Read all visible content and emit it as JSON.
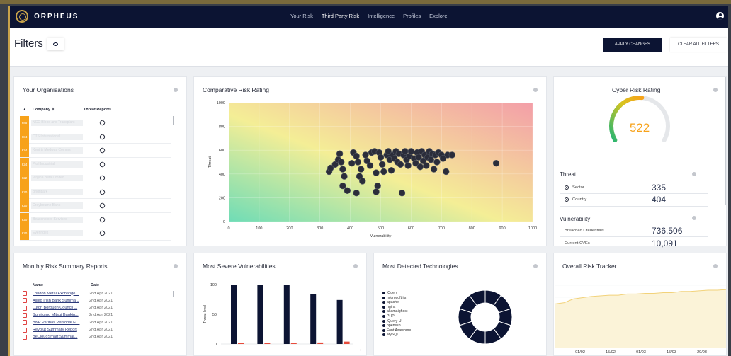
{
  "nav": {
    "brand": "ORPHEUS",
    "links": [
      "Your Risk",
      "Third Party Risk",
      "Intelligence",
      "Profiles",
      "Explore"
    ],
    "active_link": "Third Party Risk"
  },
  "filters": {
    "title": "Filters",
    "apply_label": "APPLY CHANGES",
    "clear_label": "CLEAR ALL FILTERS"
  },
  "organisations": {
    "title": "Your Organisations",
    "columns": [
      "Company ⇕",
      "Threat Reports"
    ],
    "rows": [
      {
        "score": "685",
        "name": "NCC Blood and Transplant"
      },
      {
        "score": "684",
        "name": "CTS International"
      },
      {
        "score": "624",
        "name": "Kent & Medway Comms"
      },
      {
        "score": "624",
        "name": "Pioil Industrial"
      },
      {
        "score": "622",
        "name": "Virgina Beta Limited"
      },
      {
        "score": "620",
        "name": "Brightlark"
      },
      {
        "score": "620",
        "name": "Graybourne Bank"
      },
      {
        "score": "620",
        "name": "Beaconsford Services"
      },
      {
        "score": "620",
        "name": "Everindex"
      }
    ]
  },
  "comparative": {
    "title": "Comparative Risk Rating"
  },
  "chart_data": [
    {
      "type": "scatter",
      "title": "Comparative Risk Rating",
      "xlabel": "Vulnerability",
      "ylabel": "Threat",
      "xlim": [
        0,
        1000
      ],
      "ylim": [
        0,
        1000
      ],
      "x_ticks": [
        "0",
        "100",
        "200",
        "300",
        "400",
        "500",
        "600",
        "700",
        "800",
        "900",
        "1000"
      ],
      "y_ticks": [
        "0",
        "200",
        "400",
        "600",
        "800",
        "1000"
      ],
      "points": [
        [
          330,
          420
        ],
        [
          335,
          450
        ],
        [
          350,
          480
        ],
        [
          360,
          520
        ],
        [
          365,
          570
        ],
        [
          370,
          500
        ],
        [
          375,
          440
        ],
        [
          380,
          380
        ],
        [
          375,
          300
        ],
        [
          390,
          260
        ],
        [
          405,
          490
        ],
        [
          410,
          580
        ],
        [
          420,
          550
        ],
        [
          425,
          500
        ],
        [
          435,
          440
        ],
        [
          430,
          380
        ],
        [
          420,
          240
        ],
        [
          440,
          340
        ],
        [
          450,
          560
        ],
        [
          455,
          510
        ],
        [
          465,
          470
        ],
        [
          470,
          580
        ],
        [
          480,
          590
        ],
        [
          485,
          410
        ],
        [
          490,
          300
        ],
        [
          485,
          250
        ],
        [
          495,
          580
        ],
        [
          500,
          540
        ],
        [
          505,
          480
        ],
        [
          510,
          420
        ],
        [
          520,
          560
        ],
        [
          525,
          590
        ],
        [
          530,
          520
        ],
        [
          535,
          430
        ],
        [
          540,
          560
        ],
        [
          545,
          530
        ],
        [
          550,
          590
        ],
        [
          555,
          500
        ],
        [
          560,
          570
        ],
        [
          565,
          480
        ],
        [
          570,
          240
        ],
        [
          575,
          560
        ],
        [
          580,
          590
        ],
        [
          585,
          520
        ],
        [
          590,
          470
        ],
        [
          595,
          550
        ],
        [
          600,
          590
        ],
        [
          610,
          530
        ],
        [
          615,
          490
        ],
        [
          620,
          580
        ],
        [
          625,
          540
        ],
        [
          630,
          460
        ],
        [
          635,
          590
        ],
        [
          640,
          510
        ],
        [
          645,
          560
        ],
        [
          650,
          470
        ],
        [
          655,
          540
        ],
        [
          660,
          590
        ],
        [
          665,
          520
        ],
        [
          670,
          570
        ],
        [
          675,
          440
        ],
        [
          680,
          560
        ],
        [
          685,
          500
        ],
        [
          690,
          580
        ],
        [
          700,
          560
        ],
        [
          705,
          530
        ],
        [
          715,
          420
        ],
        [
          720,
          560
        ],
        [
          735,
          560
        ],
        [
          880,
          490
        ]
      ]
    },
    {
      "type": "bar",
      "title": "Most Severe Vulnerabilities",
      "ylabel": "Threat level",
      "ylim": [
        0,
        100
      ],
      "y_ticks": [
        "0",
        "50",
        "100"
      ],
      "series": [
        {
          "values": [
            100,
            100,
            100,
            84,
            74
          ]
        },
        {
          "values": [
            1.5,
            2,
            2,
            2.5,
            4
          ]
        }
      ],
      "colors": [
        "#0c1433",
        "#e74c3c"
      ]
    },
    {
      "type": "pie",
      "title": "Most Detected Technologies",
      "categories": [
        "jQuery",
        "microsoft iis",
        "apache",
        "nginx",
        "akamaighost",
        "PHP",
        "jQuery UI",
        "openssh",
        "Font Awesome",
        "MySQL"
      ],
      "values": [
        10,
        10,
        10,
        10,
        10,
        10,
        10,
        10,
        10,
        10
      ]
    },
    {
      "type": "area",
      "title": "Overall Risk Tracker",
      "x_ticks": [
        "01/02",
        "15/02",
        "01/03",
        "15/03",
        "29/03"
      ],
      "values": [
        0.7,
        0.72,
        0.78,
        0.8,
        0.82,
        0.83,
        0.84,
        0.84,
        0.86,
        0.86,
        0.87,
        0.87,
        0.88,
        0.88,
        0.9,
        0.9,
        0.91,
        0.92,
        0.92,
        0.93
      ]
    }
  ],
  "cyber": {
    "title": "Cyber Risk Rating",
    "score": "522",
    "gauge_fraction": 0.52,
    "threat_label": "Threat",
    "threat_rows": [
      {
        "label": "Sector",
        "value": "335"
      },
      {
        "label": "Country",
        "value": "404"
      }
    ],
    "vuln_label": "Vulnerability",
    "vuln_rows": [
      {
        "label": "Breached Credentials",
        "value": "736,506"
      },
      {
        "label": "Current CVEs",
        "value": "10,091"
      }
    ]
  },
  "reports": {
    "title": "Monthly Risk Summary Reports",
    "columns": [
      "Name",
      "Date"
    ],
    "rows": [
      {
        "name": "London Metal Exchange...",
        "date": "2nd Apr 2021"
      },
      {
        "name": "Allied Irish Bank Summa...",
        "date": "2nd Apr 2021"
      },
      {
        "name": "Luton Borough Council ...",
        "date": "2nd Apr 2021"
      },
      {
        "name": "Sumitomo Mitsui Bankin...",
        "date": "2nd Apr 2021"
      },
      {
        "name": "BNP Paribas Personal Fi...",
        "date": "2nd Apr 2021"
      },
      {
        "name": "Revolut Summary Report",
        "date": "2nd Apr 2021"
      },
      {
        "name": "BeCloudSmart Summar...",
        "date": "2nd Apr 2021"
      }
    ]
  },
  "vulns": {
    "title": "Most Severe Vulnerabilities",
    "arrow": "→"
  },
  "tech": {
    "title": "Most Detected Technologies"
  },
  "tracker": {
    "title": "Overall Risk Tracker"
  },
  "colors": {
    "navy": "#0c1433",
    "accent": "#f7a21a",
    "gauge_green": "#22b573"
  }
}
